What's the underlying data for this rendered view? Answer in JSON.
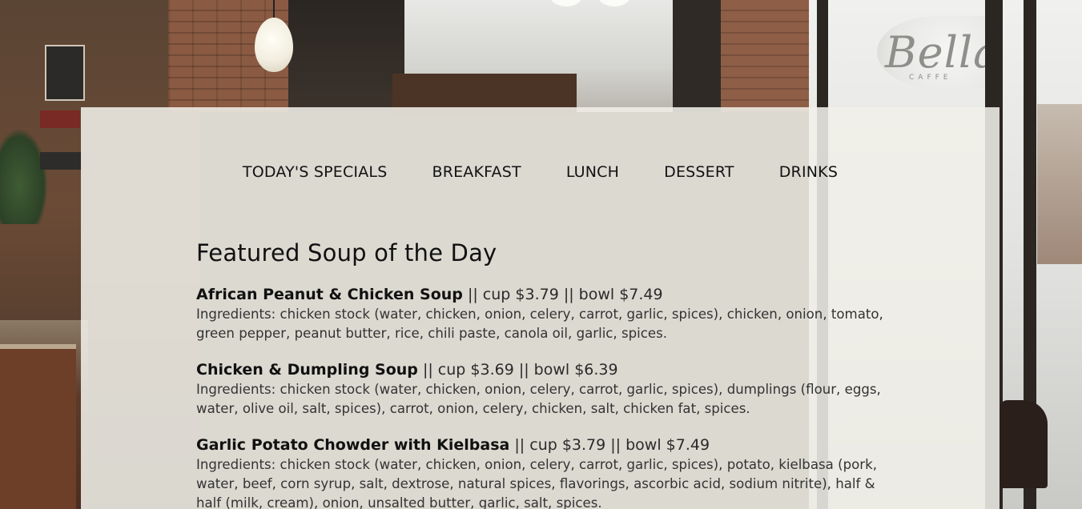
{
  "nav": {
    "items": [
      {
        "label": "TODAY'S SPECIALS"
      },
      {
        "label": "BREAKFAST"
      },
      {
        "label": "LUNCH"
      },
      {
        "label": "DESSERT"
      },
      {
        "label": "DRINKS"
      }
    ]
  },
  "section": {
    "title": "Featured Soup of the Day"
  },
  "soups": [
    {
      "name": "African Peanut & Chicken Soup",
      "price": " || cup $3.79 || bowl $7.49",
      "ingredients": "Ingredients: chicken stock (water, chicken, onion, celery, carrot, garlic, spices), chicken, onion, tomato, green pepper, peanut butter, rice, chili paste, canola oil, garlic, spices."
    },
    {
      "name": "Chicken & Dumpling Soup",
      "price": " || cup $3.69 || bowl $6.39",
      "ingredients": "Ingredients: chicken stock (water, chicken, onion, celery, carrot, garlic, spices), dumplings (flour, eggs, water, olive oil, salt, spices), carrot, onion, celery, chicken, salt, chicken fat, spices."
    },
    {
      "name": "Garlic Potato Chowder with Kielbasa",
      "price": " || cup $3.79 || bowl $7.49",
      "ingredients": "Ingredients: chicken stock (water, chicken, onion, celery, carrot, garlic, spices), potato, kielbasa (pork, water, beef, corn syrup, salt, dextrose, natural spices, flavorings, ascorbic acid, sodium nitrite), half & half (milk, cream), onion, unsalted butter, garlic, salt, spices."
    }
  ],
  "background": {
    "logo_text": "Bella",
    "logo_sub": "CAFFE",
    "overlay_color": "#F0EFE8"
  }
}
